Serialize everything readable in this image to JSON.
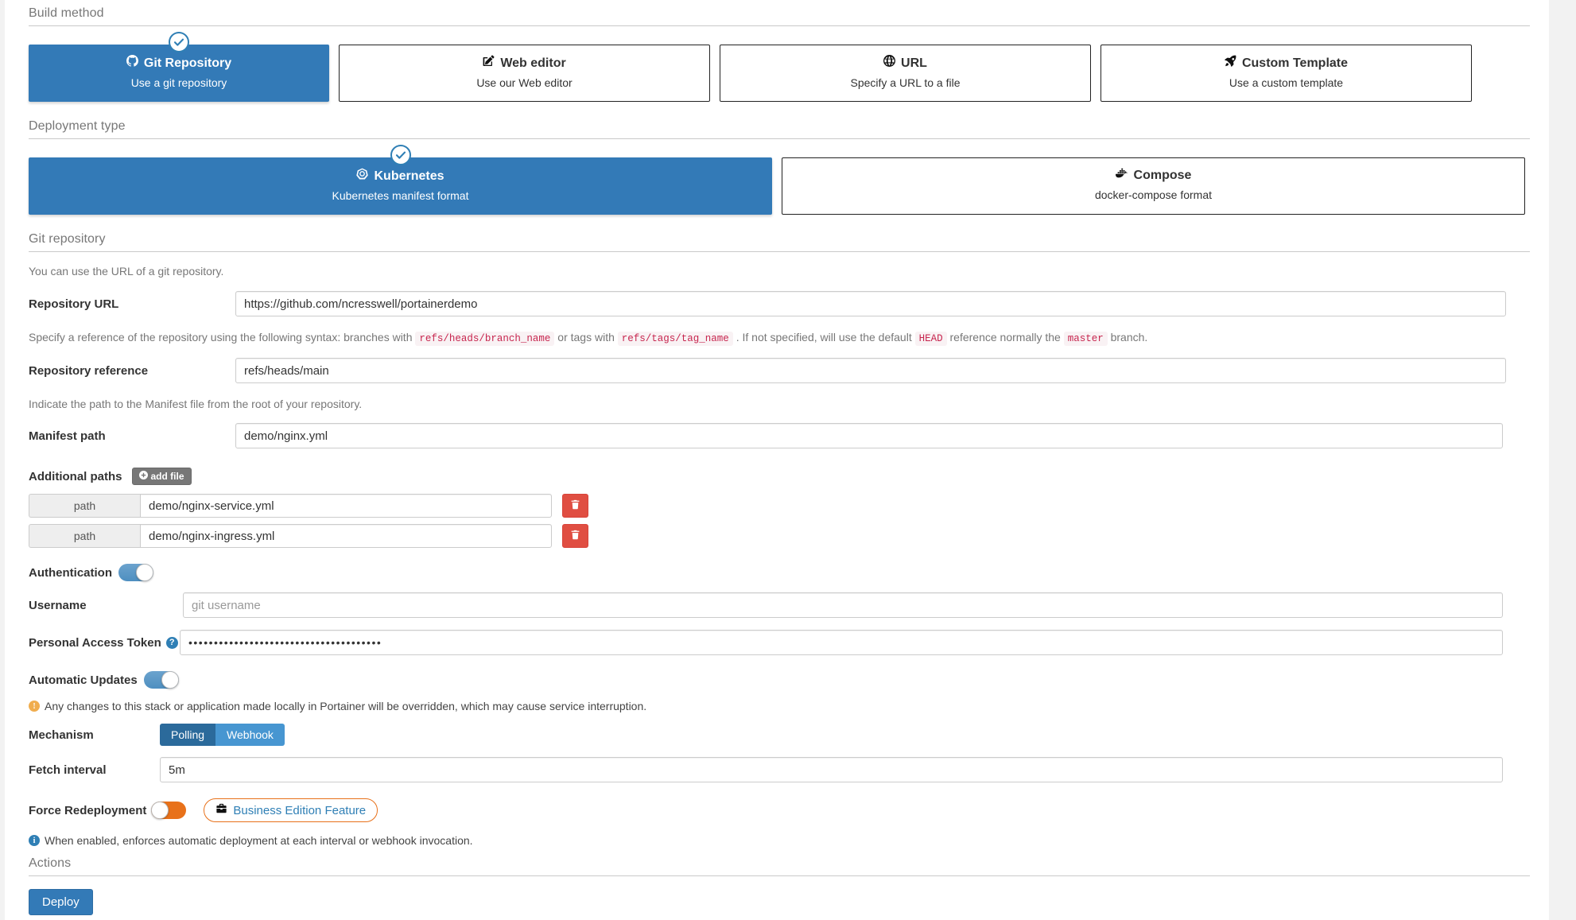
{
  "build_method": {
    "section_title": "Build method",
    "options": [
      {
        "title": "Git Repository",
        "subtitle": "Use a git repository",
        "icon": "github-icon",
        "selected": true
      },
      {
        "title": "Web editor",
        "subtitle": "Use our Web editor",
        "icon": "pencil-square-icon",
        "selected": false
      },
      {
        "title": "URL",
        "subtitle": "Specify a URL to a file",
        "icon": "globe-icon",
        "selected": false
      },
      {
        "title": "Custom Template",
        "subtitle": "Use a custom template",
        "icon": "rocket-icon",
        "selected": false
      }
    ]
  },
  "deployment_type": {
    "section_title": "Deployment type",
    "options": [
      {
        "title": "Kubernetes",
        "subtitle": "Kubernetes manifest format",
        "icon": "kubernetes-icon",
        "selected": true
      },
      {
        "title": "Compose",
        "subtitle": "docker-compose format",
        "icon": "docker-icon",
        "selected": false
      }
    ]
  },
  "git_repository": {
    "section_title": "Git repository",
    "intro": "You can use the URL of a git repository.",
    "repository_url": {
      "label": "Repository URL",
      "value": "https://github.com/ncresswell/portainerdemo"
    },
    "reference_help": {
      "part1": "Specify a reference of the repository using the following syntax: branches with",
      "code1": "refs/heads/branch_name",
      "part2": "or tags with",
      "code2": "refs/tags/tag_name",
      "part3": ". If not specified, will use the default",
      "code3": "HEAD",
      "part4": "reference normally the",
      "code4": "master",
      "part5": "branch."
    },
    "repository_reference": {
      "label": "Repository reference",
      "value": "refs/heads/main"
    },
    "manifest_help": "Indicate the path to the Manifest file from the root of your repository.",
    "manifest_path": {
      "label": "Manifest path",
      "value": "demo/nginx.yml"
    },
    "additional_paths": {
      "label": "Additional paths",
      "add_button": "add file",
      "rows": [
        {
          "addon": "path",
          "value": "demo/nginx-service.yml",
          "delete_icon": "trash-icon"
        },
        {
          "addon": "path",
          "value": "demo/nginx-ingress.yml",
          "delete_icon": "trash-icon"
        }
      ]
    },
    "authentication": {
      "label": "Authentication",
      "enabled": true,
      "username": {
        "label": "Username",
        "value": "",
        "placeholder": "git username"
      },
      "token": {
        "label": "Personal Access Token",
        "value": "••••••••••••••••••••••••••••••••••••••",
        "help_icon": "question-mark-icon"
      }
    },
    "automatic_updates": {
      "label": "Automatic Updates",
      "enabled": true,
      "warning": "Any changes to this stack or application made locally in Portainer will be overridden, which may cause service interruption.",
      "mechanism": {
        "label": "Mechanism",
        "options": [
          "Polling",
          "Webhook"
        ],
        "selected": "Polling"
      },
      "fetch_interval": {
        "label": "Fetch interval",
        "value": "5m"
      },
      "force_redeployment": {
        "label": "Force Redeployment",
        "enabled": false,
        "badge": "Business Edition Feature",
        "badge_icon": "briefcase-icon",
        "info": "When enabled, enforces automatic deployment at each interval or webhook invocation."
      }
    }
  },
  "actions": {
    "section_title": "Actions",
    "deploy_label": "Deploy"
  },
  "colors": {
    "accent_blue": "#337ab7",
    "danger_red": "#e04e42",
    "orange": "#e8711a",
    "warning_amber": "#f0ad4e"
  }
}
